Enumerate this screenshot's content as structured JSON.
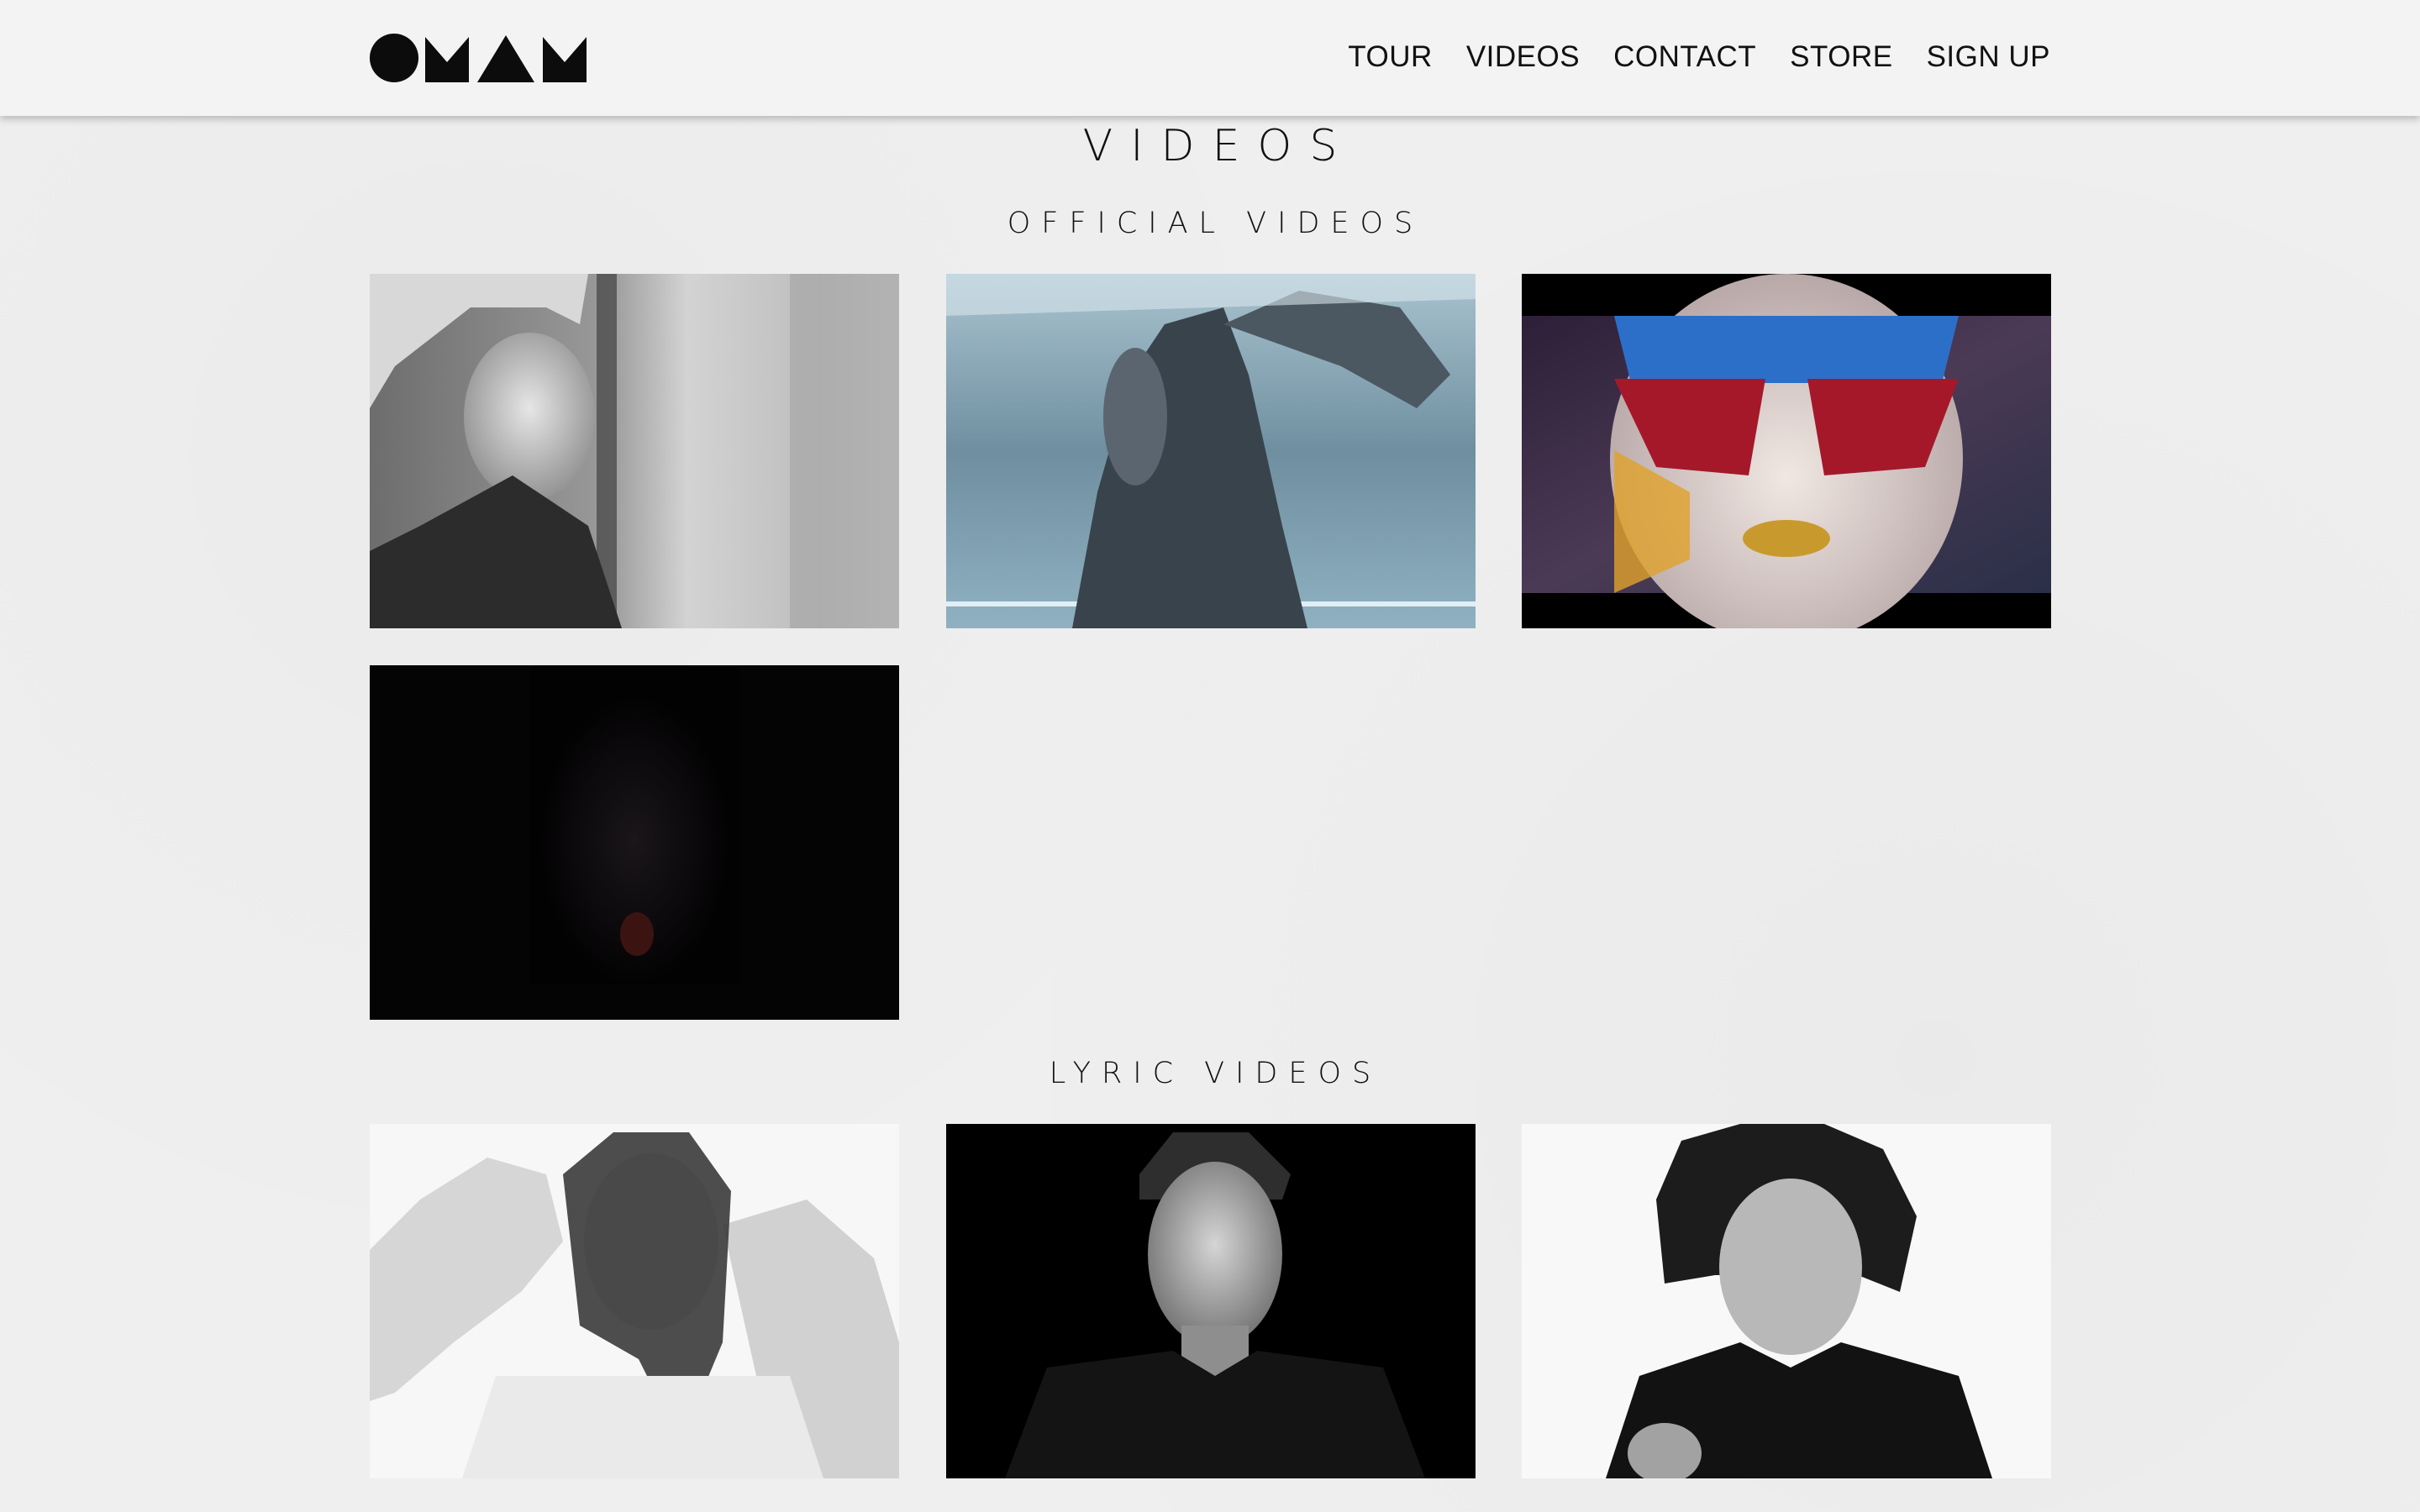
{
  "header": {
    "logo_text": "OMAM",
    "nav": [
      {
        "label": "TOUR"
      },
      {
        "label": "VIDEOS"
      },
      {
        "label": "CONTACT"
      },
      {
        "label": "STORE"
      },
      {
        "label": "SIGN UP"
      }
    ]
  },
  "page": {
    "title": "VIDEOS"
  },
  "sections": [
    {
      "title": "OFFICIAL VIDEOS",
      "videos": [
        {
          "thumbnail": "grayscale-woman-at-window"
        },
        {
          "thumbnail": "upside-down-woman-underwater"
        },
        {
          "thumbnail": "painted-face-gold-lips"
        },
        {
          "thumbnail": "dark-cave-figure"
        }
      ]
    },
    {
      "title": "LYRIC VIDEOS",
      "videos": [
        {
          "thumbnail": "woman-hands-on-head"
        },
        {
          "thumbnail": "man-dark-background"
        },
        {
          "thumbnail": "curly-hair-woman-singing"
        }
      ]
    }
  ]
}
